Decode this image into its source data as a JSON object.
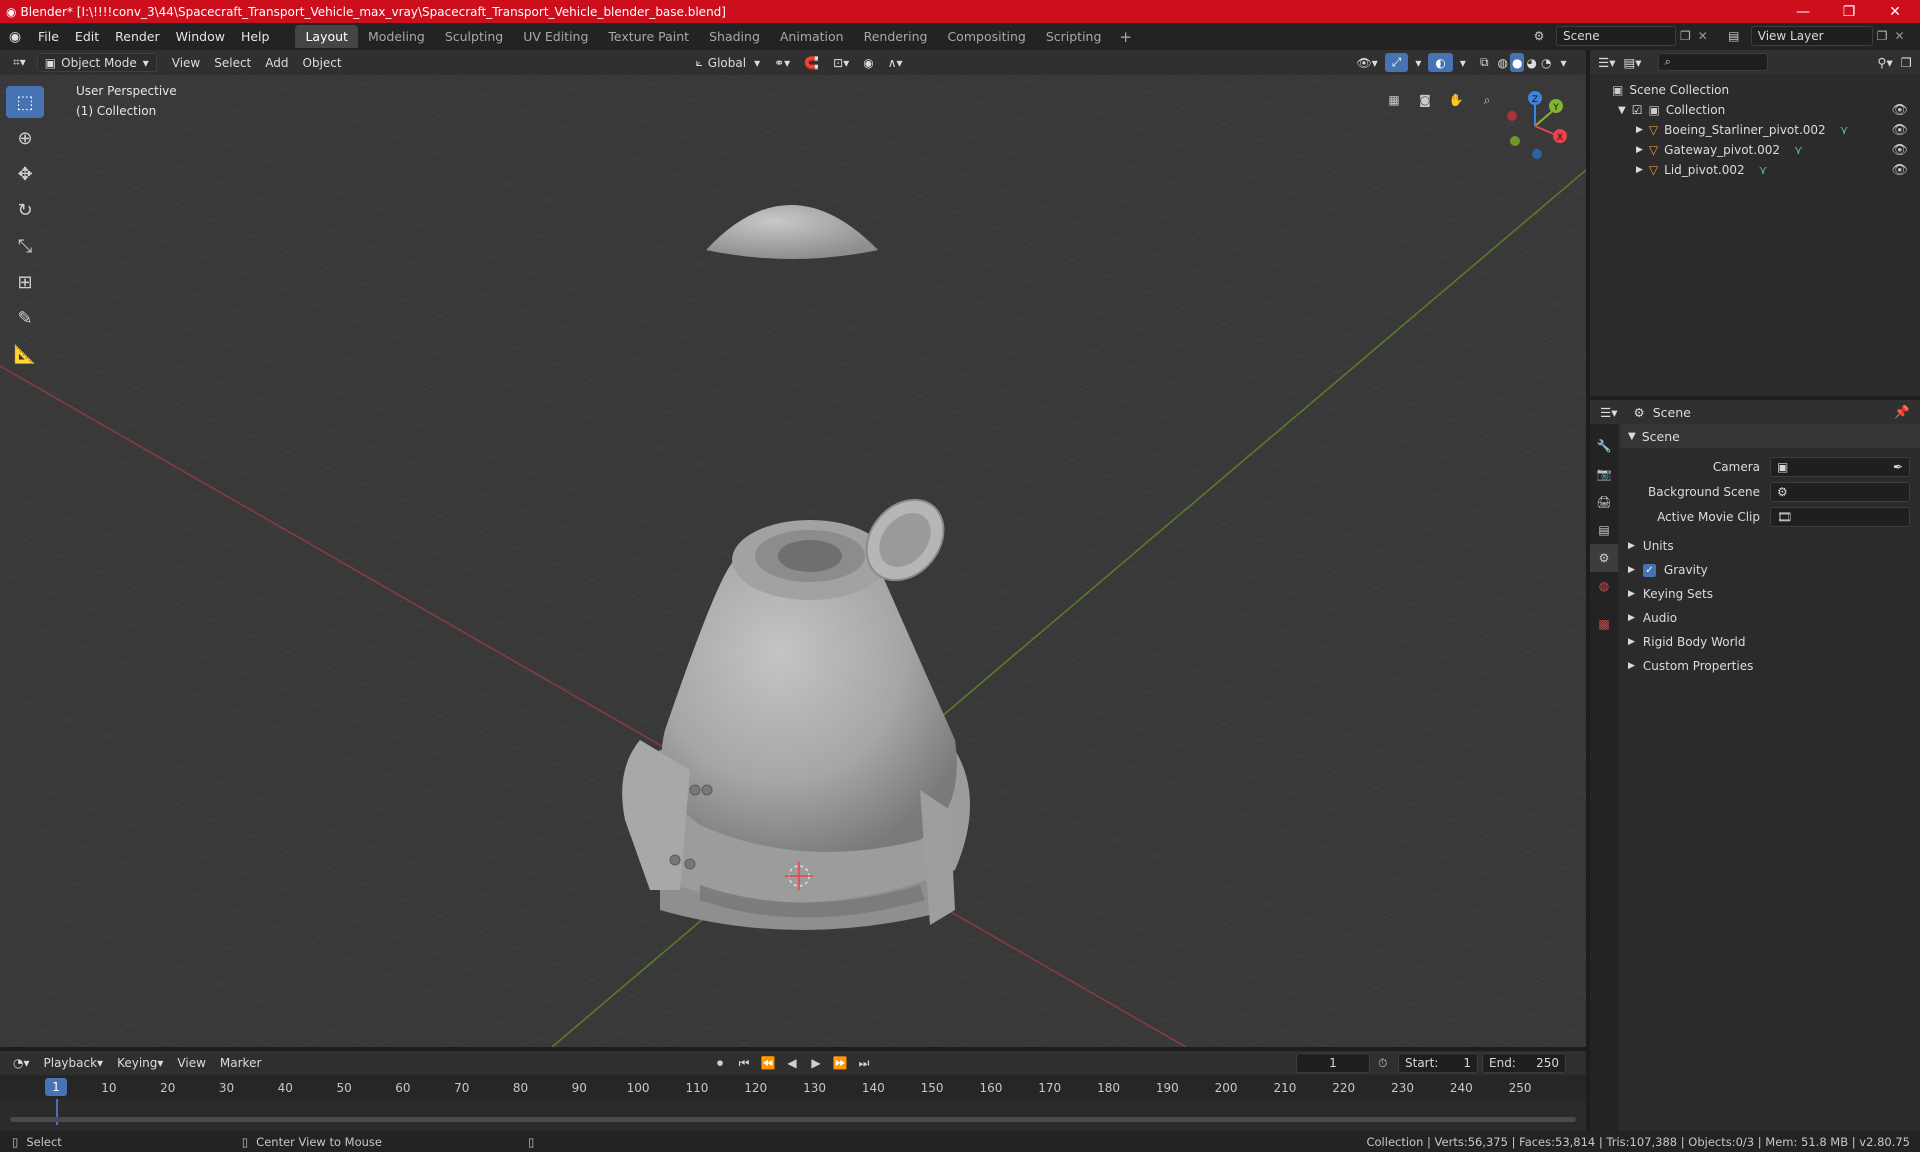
{
  "window": {
    "title": "Blender* [I:\\!!!!conv_3\\44\\Spacecraft_Transport_Vehicle_max_vray\\Spacecraft_Transport_Vehicle_blender_base.blend]",
    "minimize": "—",
    "maximize": "❐",
    "close": "✕"
  },
  "menu": [
    "File",
    "Edit",
    "Render",
    "Window",
    "Help"
  ],
  "workspaces": [
    "Layout",
    "Modeling",
    "Sculpting",
    "UV Editing",
    "Texture Paint",
    "Shading",
    "Animation",
    "Rendering",
    "Compositing",
    "Scripting"
  ],
  "active_workspace": "Layout",
  "scene_field": "Scene",
  "view_layer_field": "View Layer",
  "viewport": {
    "mode": "Object Mode",
    "menus": [
      "View",
      "Select",
      "Add",
      "Object"
    ],
    "orientation": "Global",
    "overlay_line1": "User Perspective",
    "overlay_line2": "(1) Collection",
    "gizmo": {
      "x": "X",
      "y": "Y",
      "z": "Z"
    }
  },
  "outliner": {
    "root": "Scene Collection",
    "collection": "Collection",
    "items": [
      "Boeing_Starliner_pivot.002",
      "Gateway_pivot.002",
      "Lid_pivot.002"
    ]
  },
  "properties": {
    "header": "Scene",
    "panel": "Scene",
    "fields": [
      {
        "label": "Camera"
      },
      {
        "label": "Background Scene"
      },
      {
        "label": "Active Movie Clip"
      }
    ],
    "sections": [
      "Units",
      "Gravity",
      "Keying Sets",
      "Audio",
      "Rigid Body World",
      "Custom Properties"
    ],
    "gravity_checked": true
  },
  "timeline": {
    "menus": [
      "Playback",
      "Keying",
      "View",
      "Marker"
    ],
    "current_frame": "1",
    "start_label": "Start:",
    "start": "1",
    "end_label": "End:",
    "end": "250",
    "ruler": [
      "1",
      "10",
      "20",
      "30",
      "40",
      "50",
      "60",
      "70",
      "80",
      "90",
      "100",
      "110",
      "120",
      "130",
      "140",
      "150",
      "160",
      "170",
      "180",
      "190",
      "200",
      "210",
      "220",
      "230",
      "240",
      "250"
    ]
  },
  "status": {
    "select": "Select",
    "center": "Center View to Mouse",
    "stats": "Collection | Verts:56,375 | Faces:53,814 | Tris:107,388 | Objects:0/3 | Mem: 51.8 MB | v2.80.75"
  },
  "colors": {
    "titlebar": "#cc0e1d",
    "accent": "#4772b3",
    "axis_x": "#e8434d",
    "axis_y": "#84b533",
    "axis_z": "#3f84e0",
    "mesh_icon": "#4fc0a0",
    "object_icon": "#e09b3a"
  }
}
